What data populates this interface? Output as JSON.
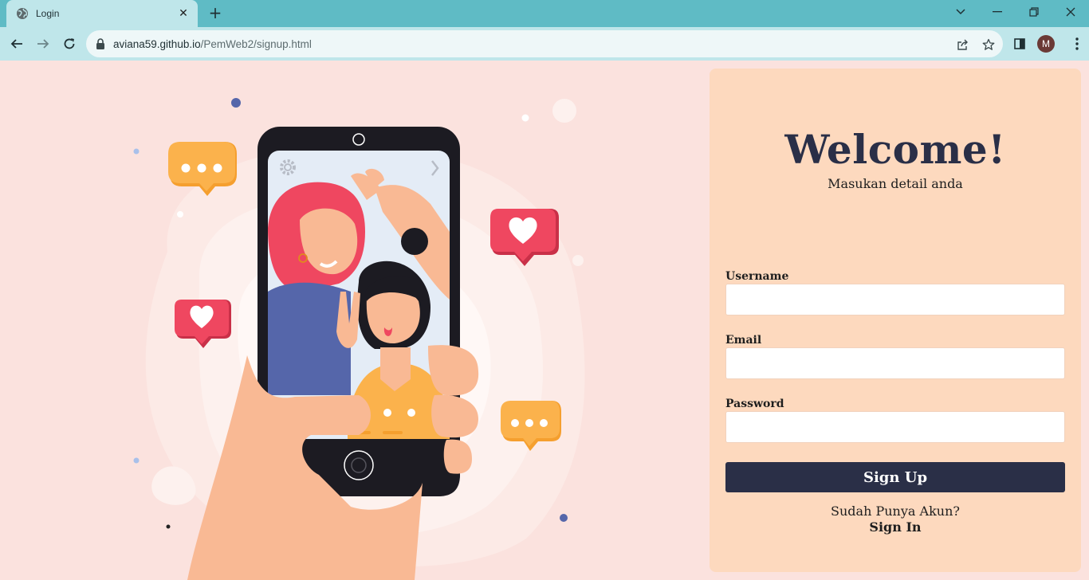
{
  "browser": {
    "tab_title": "Login",
    "url_host": "aviana59.github.io",
    "url_path": "/PemWeb2/signup.html",
    "profile_initial": "M"
  },
  "card": {
    "title": "Welcome!",
    "subtitle": "Masukan detail anda",
    "username_label": "Username",
    "email_label": "Email",
    "password_label": "Password",
    "username_value": "",
    "email_value": "",
    "password_value": "",
    "signup_label": "Sign Up",
    "have_account_text": "Sudah Punya Akun?",
    "signin_label": "Sign In"
  },
  "colors": {
    "page_bg": "#fbe2de",
    "card_bg": "#fdd9be",
    "button_bg": "#2a2f47",
    "heart_red": "#ef4760",
    "chat_orange": "#fbb24c"
  }
}
